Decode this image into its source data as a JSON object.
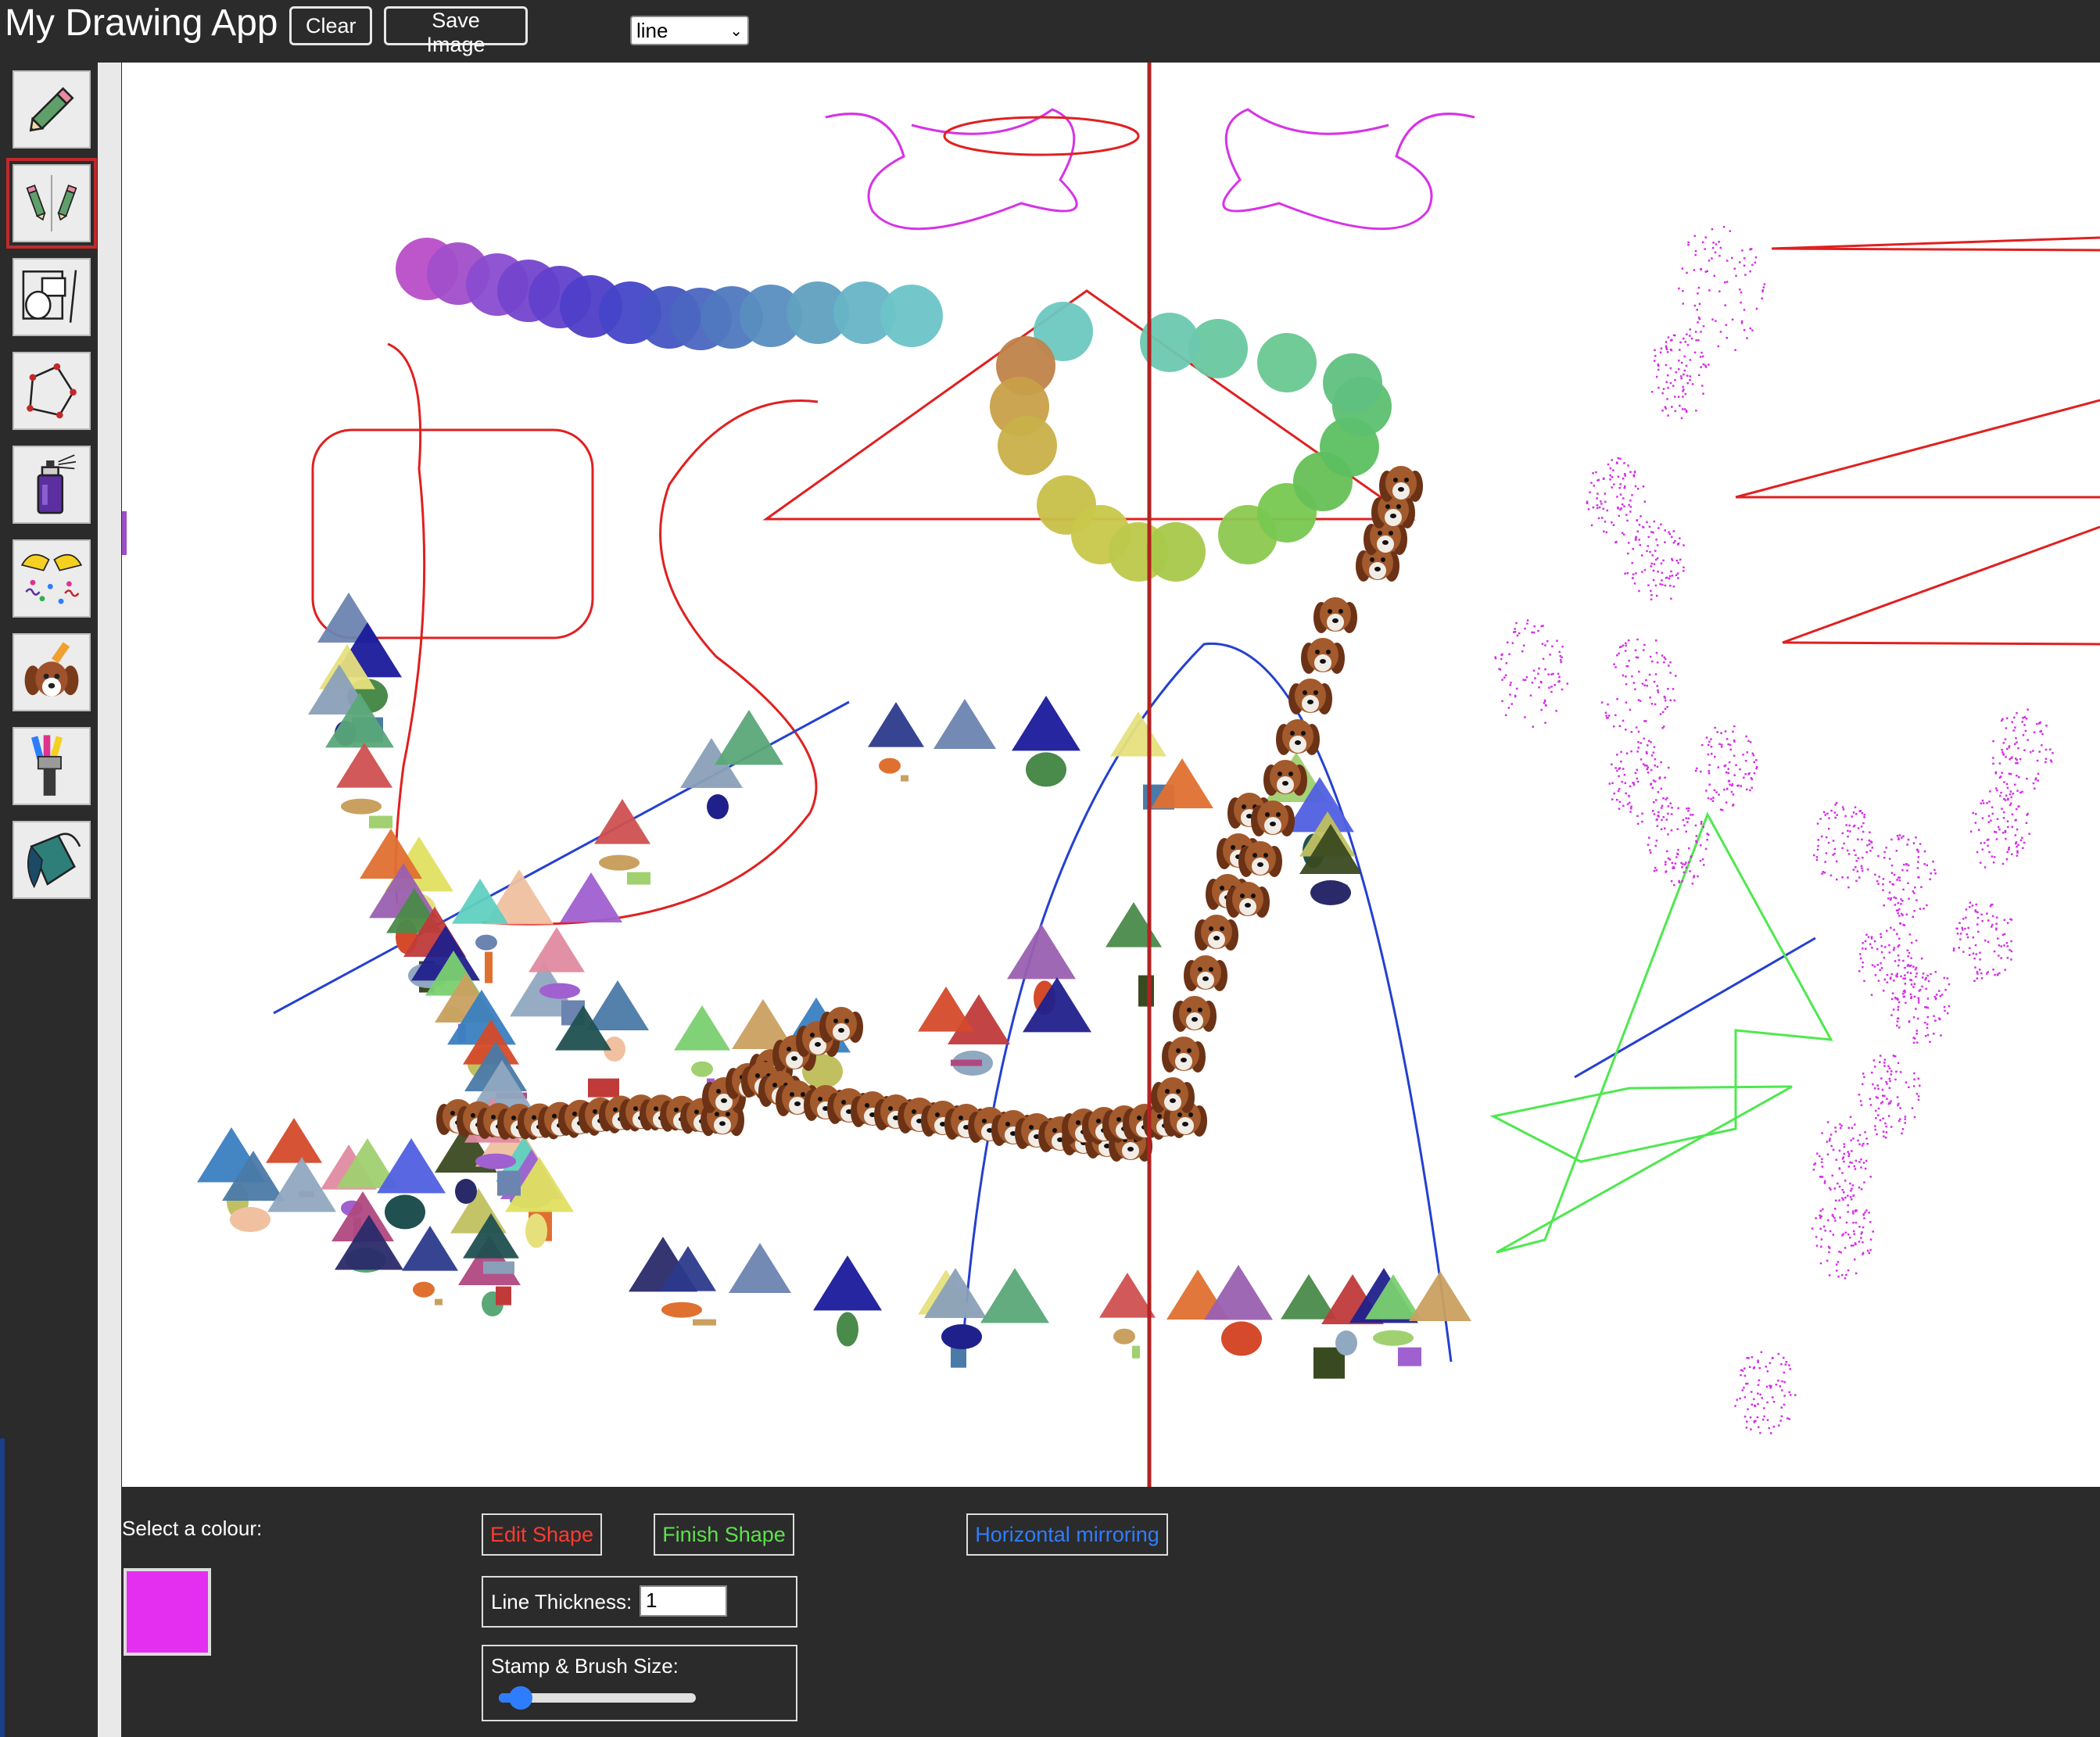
{
  "header": {
    "title": "My Drawing App",
    "clear_label": "Clear",
    "save_label": "Save Image",
    "shape_select_value": "line"
  },
  "sidebar": {
    "tools": [
      {
        "name": "pencil-tool",
        "icon": "pencil-icon",
        "selected": false
      },
      {
        "name": "mirror-draw-tool",
        "icon": "mirror-pencils-icon",
        "selected": true
      },
      {
        "name": "shapes-tool",
        "icon": "shapes-icon",
        "selected": false
      },
      {
        "name": "polygon-tool",
        "icon": "polygon-icon",
        "selected": false
      },
      {
        "name": "spray-can-tool",
        "icon": "spray-can-icon",
        "selected": false
      },
      {
        "name": "confetti-tool",
        "icon": "confetti-icon",
        "selected": false
      },
      {
        "name": "stamp-tool",
        "icon": "dog-stamp-icon",
        "selected": false
      },
      {
        "name": "brush-tool",
        "icon": "paint-brush-icon",
        "selected": false
      },
      {
        "name": "fill-tool",
        "icon": "paint-bucket-icon",
        "selected": false
      }
    ]
  },
  "controls": {
    "select_colour_label": "Select a colour:",
    "selected_colour": "#e42ef0",
    "edit_shape_label": "Edit Shape",
    "finish_shape_label": "Finish Shape",
    "mirror_label": "Horizontal mirroring",
    "line_thickness_label": "Line Thickness:",
    "line_thickness_value": "1",
    "stamp_brush_size_label": "Stamp & Brush Size:",
    "stamp_brush_size_fraction": 0.05
  },
  "colors": {
    "background": "#2b2b2b",
    "canvas": "#ffffff",
    "mirror_line": "#b22222",
    "selected_tool_outline": "#c0292b",
    "edit_shape_text": "#ff3b30",
    "finish_shape_text": "#5ee04e",
    "mirror_text": "#2f7dff"
  }
}
